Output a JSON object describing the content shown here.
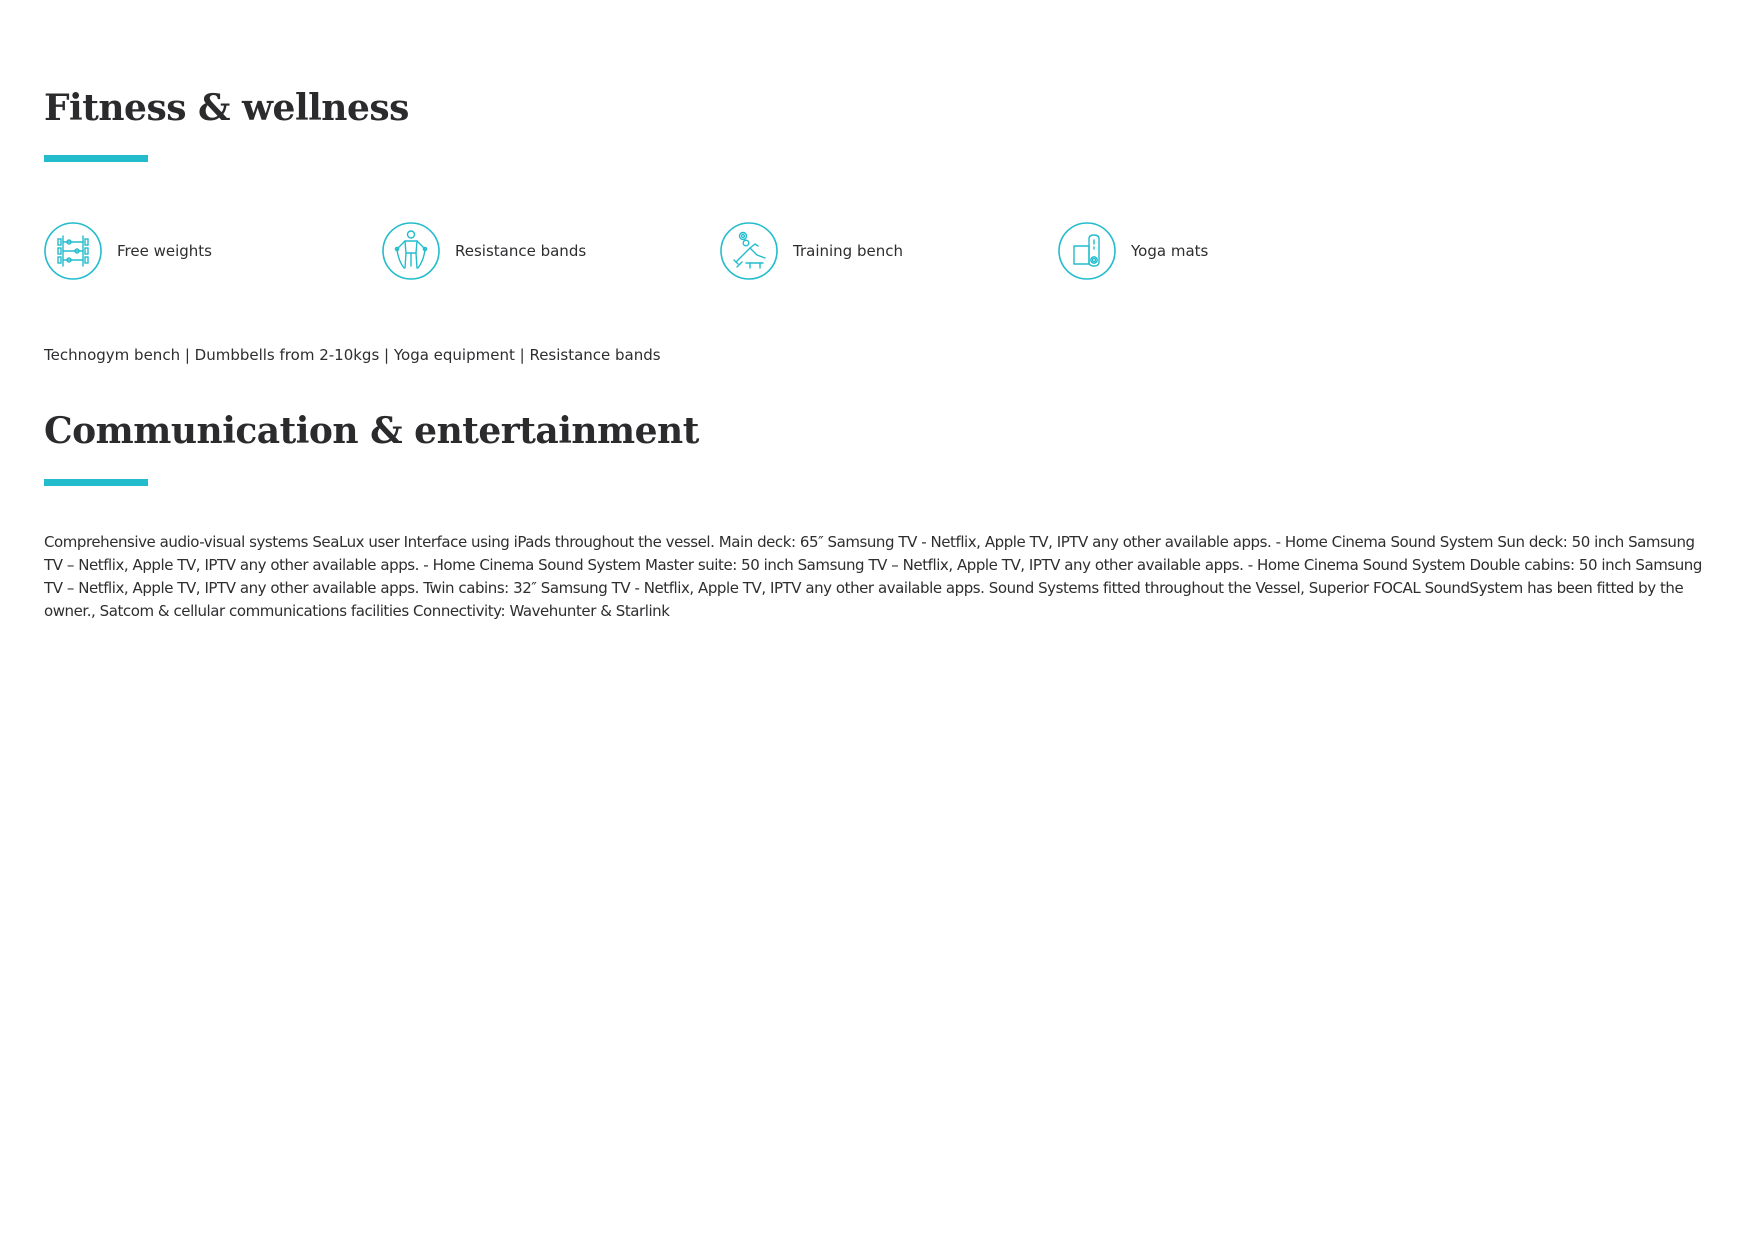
{
  "fitness": {
    "heading": "Fitness & wellness",
    "amenities": [
      {
        "label": "Free weights",
        "icon": "free-weights-icon"
      },
      {
        "label": "Resistance bands",
        "icon": "resistance-bands-icon"
      },
      {
        "label": "Training bench",
        "icon": "training-bench-icon"
      },
      {
        "label": "Yoga mats",
        "icon": "yoga-mats-icon"
      }
    ],
    "summary": "Technogym bench | Dumbbells from 2-10kgs | Yoga equipment | Resistance bands"
  },
  "communication": {
    "heading": "Communication & entertainment",
    "description": "Comprehensive audio-visual systems SeaLux user Interface using iPads throughout the vessel. Main deck: 65″ Samsung TV - Netflix, Apple TV, IPTV any other available apps. - Home Cinema Sound System Sun deck: 50 inch Samsung TV – Netflix, Apple TV, IPTV any other available apps. - Home Cinema Sound System Master suite: 50 inch Samsung TV – Netflix, Apple TV, IPTV any other available apps. - Home Cinema Sound System Double cabins: 50 inch Samsung TV – Netflix, Apple TV, IPTV any other available apps. Twin cabins: 32″ Samsung TV - Netflix, Apple TV, IPTV any other available apps. Sound Systems fitted throughout the Vessel, Superior FOCAL SoundSystem has been fitted by the owner., Satcom & cellular communications facilities Connectivity: Wavehunter & Starlink"
  },
  "colors": {
    "accent": "#23bccd",
    "text": "#2e2e30",
    "background": "#ffffff"
  }
}
